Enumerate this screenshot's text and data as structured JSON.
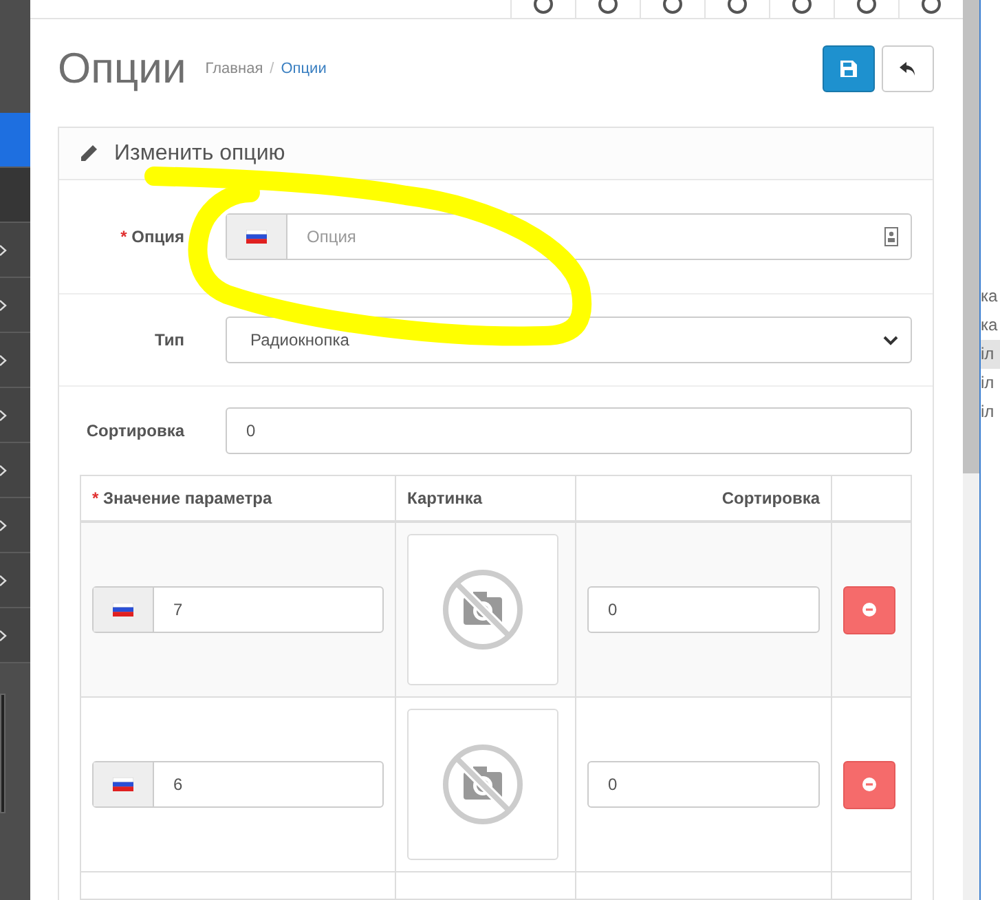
{
  "sidebar": {
    "items": [
      {
        "kind": "plain",
        "selected": true
      },
      {
        "kind": "plain",
        "selected": false
      },
      {
        "kind": "submenu",
        "selected": false
      },
      {
        "kind": "submenu",
        "selected": false
      },
      {
        "kind": "submenu",
        "selected": false
      },
      {
        "kind": "submenu",
        "selected": false
      },
      {
        "kind": "submenu",
        "selected": false
      },
      {
        "kind": "submenu",
        "selected": false
      },
      {
        "kind": "submenu",
        "selected": false
      },
      {
        "kind": "submenu",
        "selected": false
      }
    ]
  },
  "page": {
    "title": "Опции",
    "breadcrumbs": [
      {
        "label": "Главная",
        "selected": false
      },
      {
        "label": "Опции",
        "selected": true
      }
    ],
    "separator": "/"
  },
  "panel": {
    "title": "Изменить опцию",
    "fields": [
      {
        "kind": "lang-input",
        "label": "Опция",
        "required_mark": "*",
        "placeholder": "Опция"
      },
      {
        "kind": "select",
        "label": "Тип",
        "value": "Радиокнопка"
      },
      {
        "kind": "input",
        "label": "Сортировка",
        "value": "0"
      }
    ],
    "table": {
      "columns": [
        {
          "label": "Значение параметра",
          "required_mark": "*"
        },
        {
          "label": "Картинка"
        },
        {
          "label": "Сортировка"
        }
      ],
      "rows": [
        {
          "value": "7",
          "sort": "0"
        },
        {
          "value": "6",
          "sort": "0"
        }
      ]
    }
  },
  "right_panel": {
    "items": [
      {
        "text": "ка",
        "selected": false
      },
      {
        "text": "ка",
        "selected": false
      },
      {
        "text": "іл",
        "selected": true
      },
      {
        "text": "іл",
        "selected": false
      },
      {
        "text": "іл",
        "selected": false
      }
    ]
  }
}
